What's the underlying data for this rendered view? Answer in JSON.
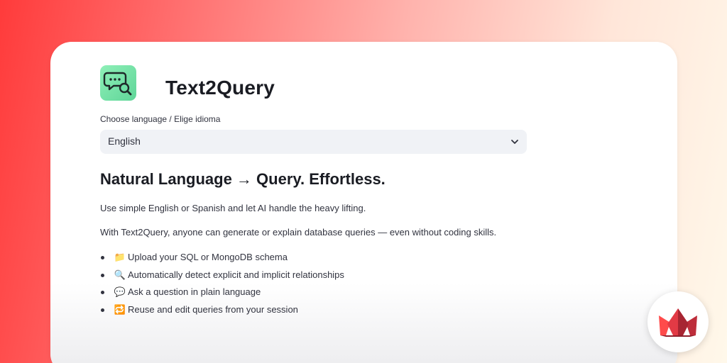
{
  "app": {
    "title": "Text2Query",
    "icon": "chat-search-icon"
  },
  "language": {
    "label": "Choose language / Elige idioma",
    "selected": "English"
  },
  "content": {
    "headline": "Natural Language → Query. Effortless.",
    "paragraph_1": "Use simple English or Spanish and let AI handle the heavy lifting.",
    "paragraph_2": "With Text2Query, anyone can generate or explain database queries — even without coding skills.",
    "features": [
      {
        "emoji": "📁",
        "text": "Upload your SQL or MongoDB schema"
      },
      {
        "emoji": "🔍",
        "text": "Automatically detect explicit and implicit relationships"
      },
      {
        "emoji": "💬",
        "text": "Ask a question in plain language"
      },
      {
        "emoji": "🔁",
        "text": "Reuse and edit queries from your session"
      }
    ]
  },
  "badge": {
    "icon": "streamlit-crown-icon"
  },
  "colors": {
    "accent_red": "#ff4b4b",
    "icon_green": "#6ee0a4",
    "select_bg": "#f0f2f6",
    "text": "#31333f"
  }
}
